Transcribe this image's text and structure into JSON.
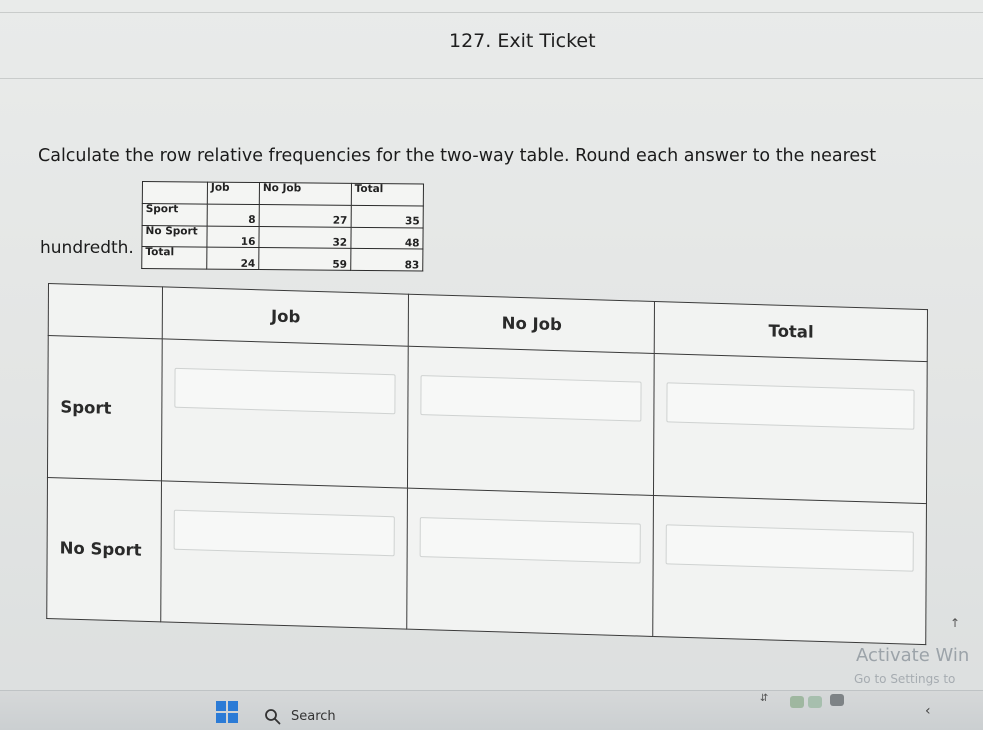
{
  "title": "127. Exit Ticket",
  "prompt": {
    "line1": "Calculate the row relative frequencies for the two-way table. Round each answer to the nearest",
    "line2": "hundredth."
  },
  "reference_table": {
    "headers": [
      "",
      "Job",
      "No Job",
      "Total"
    ],
    "rows": [
      [
        "Sport",
        "8",
        "27",
        "35"
      ],
      [
        "No Sport",
        "16",
        "32",
        "48"
      ],
      [
        "Total",
        "24",
        "59",
        "83"
      ]
    ]
  },
  "answer_table": {
    "headers": [
      "",
      "Job",
      "No Job",
      "Total"
    ],
    "rows": [
      {
        "label": "Sport",
        "cells": [
          "",
          "",
          ""
        ]
      },
      {
        "label": "No Sport",
        "cells": [
          "",
          "",
          ""
        ]
      }
    ]
  },
  "watermark": {
    "title": "Activate Win",
    "subtitle": "Go to Settings to"
  },
  "taskbar": {
    "search_label": "Search",
    "start_icon": "windows-logo-icon",
    "search_icon": "search-icon",
    "accent": "#2b7bd6"
  }
}
